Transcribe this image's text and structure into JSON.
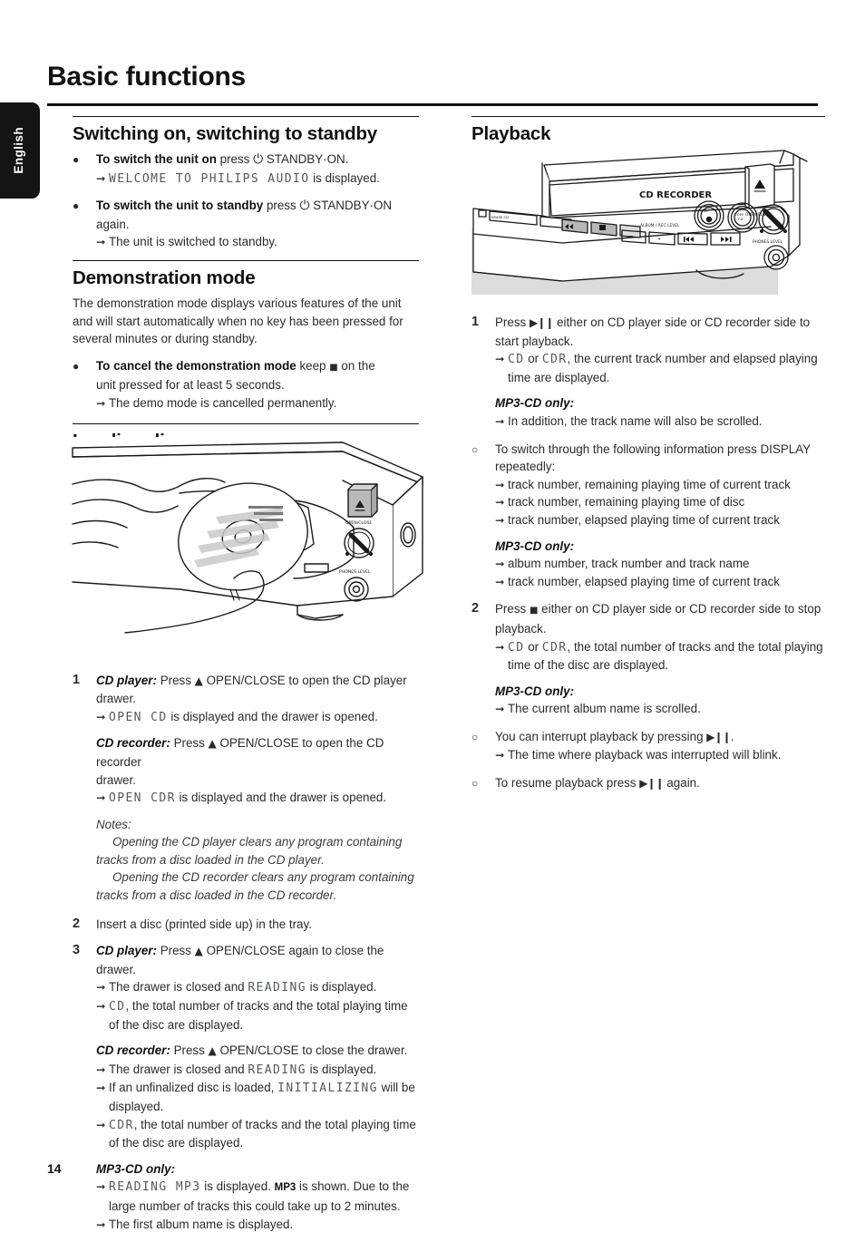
{
  "sidebar": {
    "language_tab": "English"
  },
  "page": {
    "title": "Basic functions",
    "number": "14"
  },
  "left_column": {
    "section1": {
      "heading": "Switching on, switching to standby",
      "items": [
        {
          "marker": "●",
          "lead_bold": "To switch the unit on",
          "text_after": " press",
          "icon": "power-icon",
          "tail": " STANDBY·ON.",
          "arrows": [
            {
              "lcd": "WELCOME TO PHILIPS AUDIO",
              "rest": " is displayed."
            }
          ]
        },
        {
          "marker": "●",
          "lead_bold": "To switch the unit to standby",
          "text_after": " press",
          "icon": "power-icon",
          "tail": " STANDBY·ON",
          "second_line": "again.",
          "arrows": [
            {
              "lcd": "",
              "rest": "The unit is switched to standby."
            }
          ]
        }
      ]
    },
    "section2": {
      "heading": "Demonstration mode",
      "paragraph": "The demonstration mode displays various features of the unit and will start automatically when no key has been pressed for several minutes or during standby.",
      "items": [
        {
          "marker": "●",
          "lead_bold": "To cancel the demonstration mode",
          "text_after": " keep",
          "icon": "stop-square-icon",
          "tail": " on the",
          "second_line": "unit pressed for at least 5 seconds.",
          "arrows": [
            {
              "lcd": "",
              "rest": "The demo mode is cancelled permanently."
            }
          ]
        }
      ]
    },
    "section3": {
      "heading": "Loading discs",
      "illustration": {
        "name": "loading-disc-illustration",
        "caption_labels": [
          "OPEN/CLOSE",
          "PHONES LEVEL"
        ]
      },
      "steps": [
        {
          "number": "1",
          "lead_bi": "CD player:",
          "text": " Press",
          "icon": "eject-triangle-icon",
          "tail": " OPEN/CLOSE to open the CD player drawer.",
          "arrows": [
            {
              "lcd": "OPEN CD",
              "rest": " is displayed and the drawer is opened."
            }
          ],
          "block2": {
            "lead_bi": "CD recorder:",
            "text": " Press",
            "icon": "eject-triangle-icon",
            "tail": " OPEN/CLOSE to open the CD recorder",
            "second_line": "drawer.",
            "arrows": [
              {
                "lcd": "OPEN CDR",
                "rest": " is displayed and the drawer is opened."
              }
            ]
          },
          "notes": {
            "label": "Notes:",
            "lines": [
              "Opening the CD player clears any program containing tracks from a disc loaded in the CD player.",
              "Opening the CD recorder clears any program containing tracks from a disc loaded in the CD recorder."
            ]
          }
        },
        {
          "number": "2",
          "text": "Insert a disc (printed side up) in the tray."
        },
        {
          "number": "3",
          "lead_bi": "CD player:",
          "text": " Press",
          "icon": "eject-triangle-icon",
          "tail": " OPEN/CLOSE again to close the drawer.",
          "arrows": [
            {
              "pre": "The drawer is closed and ",
              "lcd": "READING",
              "rest": " is displayed."
            },
            {
              "lcd": "CD",
              "rest": ", the total number of tracks and the total playing time of the disc are displayed."
            }
          ],
          "block2": {
            "lead_bi": "CD recorder:",
            "text": " Press",
            "icon": "eject-triangle-icon",
            "tail": " OPEN/CLOSE to close the drawer.",
            "arrows": [
              {
                "pre": "The drawer is closed and ",
                "lcd": "READING",
                "rest": " is displayed."
              },
              {
                "pre": "If an unfinalized disc is loaded, ",
                "lcd": "INITIALIZING",
                "rest": " will be displayed."
              },
              {
                "lcd": "CDR",
                "rest": ", the total number of tracks and the total playing time of the disc are displayed."
              }
            ]
          },
          "mp3": {
            "subhead": "MP3-CD only:",
            "arrows": [
              {
                "lcd": "READING MP3",
                "rest": " is displayed. ",
                "tag": "MP3",
                "rest2": " is shown. Due to the large number of tracks this could take up to 2 minutes."
              },
              {
                "lcd": "",
                "rest": "The first album name is displayed."
              }
            ]
          }
        }
      ]
    }
  },
  "right_column": {
    "section": {
      "heading": "Playback",
      "illustration": {
        "name": "cd-recorder-panel-illustration",
        "labels": [
          "CD RECORDER",
          "OPEN/CLOSE",
          "ALBUM / REC LEVEL",
          "REC",
          "COPY CD",
          "PHONES LEVEL",
          "ERASE CD"
        ]
      },
      "steps": [
        {
          "number": "1",
          "text": "Press",
          "icon": "play-pause-icon",
          "tail": " either on CD player side or CD recorder side to start playback.",
          "arrows": [
            {
              "lcd": "CD",
              "mid": " or ",
              "lcd2": "CDR",
              "rest": ", the current track number and elapsed playing time are displayed."
            }
          ],
          "mp3": {
            "subhead": "MP3-CD only:",
            "arrows": [
              {
                "lcd": "",
                "rest": "In addition, the track name will also be scrolled."
              }
            ]
          }
        },
        {
          "marker": "○",
          "text": "To switch through the following information press DISPLAY repeatedly:",
          "arrows": [
            {
              "lcd": "",
              "rest": "track number, remaining playing time of current track"
            },
            {
              "lcd": "",
              "rest": "track number, remaining playing time of disc"
            },
            {
              "lcd": "",
              "rest": "track number, elapsed playing time of current track"
            }
          ],
          "mp3": {
            "subhead": "MP3-CD only:",
            "arrows": [
              {
                "lcd": "",
                "rest": "album number, track number and track name"
              },
              {
                "lcd": "",
                "rest": "track number, elapsed playing time of current track"
              }
            ]
          }
        },
        {
          "number": "2",
          "text": "Press",
          "icon": "stop-square-icon",
          "tail": " either on CD player side or CD recorder side to stop playback.",
          "arrows": [
            {
              "lcd": "CD",
              "mid": " or ",
              "lcd2": "CDR",
              "rest": ", the total number of tracks and the total playing time of the disc are displayed."
            }
          ],
          "mp3": {
            "subhead": "MP3-CD only:",
            "arrows": [
              {
                "lcd": "",
                "rest": "The current album name is scrolled."
              }
            ]
          }
        },
        {
          "marker": "○",
          "text": "You can interrupt playback by pressing",
          "icon": "play-pause-icon",
          "tail": ".",
          "arrows": [
            {
              "lcd": "",
              "rest": "The time where playback was interrupted will blink."
            }
          ]
        },
        {
          "marker": "○",
          "text": "To resume playback press",
          "icon": "play-pause-icon",
          "tail": " again."
        }
      ]
    }
  }
}
